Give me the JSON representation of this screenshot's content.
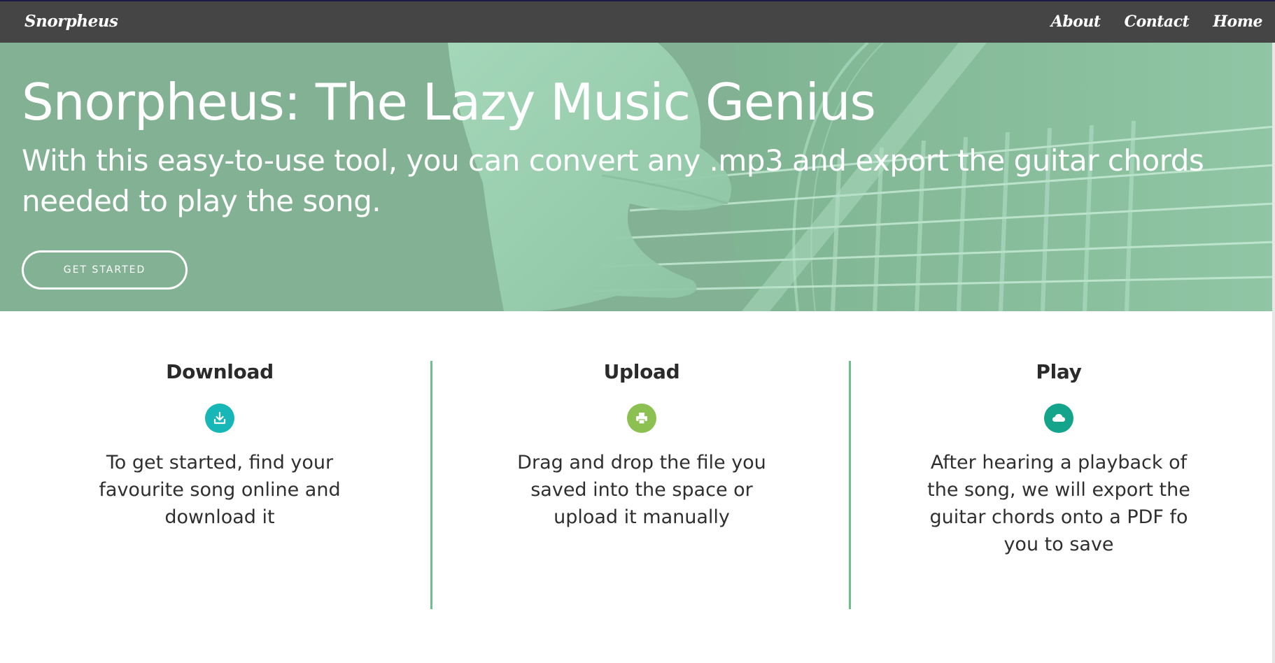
{
  "navbar": {
    "brand": "Snorpheus",
    "links": [
      "About",
      "Contact",
      "Home"
    ]
  },
  "hero": {
    "title": "Snorpheus: The Lazy Music Genius",
    "subtitle": "With this easy-to-use tool, you can convert any .mp3 and export the guitar chords needed to play the song.",
    "cta_label": "GET STARTED"
  },
  "features": [
    {
      "title": "Download",
      "icon": "download-icon",
      "icon_color": "#17b7b7",
      "text": "To get started, find your favourite song online and download it"
    },
    {
      "title": "Upload",
      "icon": "printer-icon",
      "icon_color": "#8cc152",
      "text": "Drag and drop the file you saved into the space or upload it manually"
    },
    {
      "title": "Play",
      "icon": "cloud-icon",
      "icon_color": "#14a38b",
      "text": "After hearing a playback of the song, we will export the guitar chords onto a PDF fo you to save"
    }
  ],
  "colors": {
    "navbar": "#454545",
    "hero_tint": "#84b394",
    "divider": "#6cc08a"
  }
}
